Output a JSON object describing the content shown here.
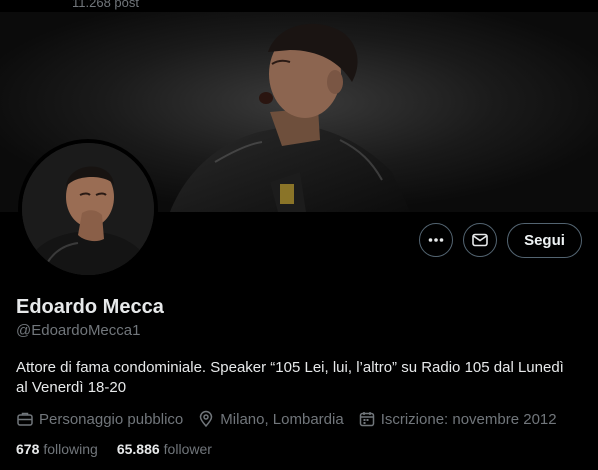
{
  "header": {
    "post_count": "11.268 post"
  },
  "actions": {
    "more_icon": "more-dots-icon",
    "message_icon": "mail-icon",
    "follow_label": "Segui"
  },
  "profile": {
    "name": "Edoardo Mecca",
    "handle": "@EdoardoMecca1",
    "bio_line1": "Attore di fama condominiale. Speaker “105 Lei, lui, l’altro” su Radio 105 dal Lunedì",
    "bio_line2": "al Venerdì 18-20",
    "category": "Personaggio pubblico",
    "location": "Milano, Lombardia",
    "joined": "Iscrizione: novembre 2012",
    "following_count": "678",
    "following_label": "following",
    "followers_count": "65.886",
    "followers_label": "follower"
  },
  "colors": {
    "background": "#000000",
    "primary_text": "#e7e9ea",
    "secondary_text": "#71767b",
    "button_border": "#536471"
  }
}
